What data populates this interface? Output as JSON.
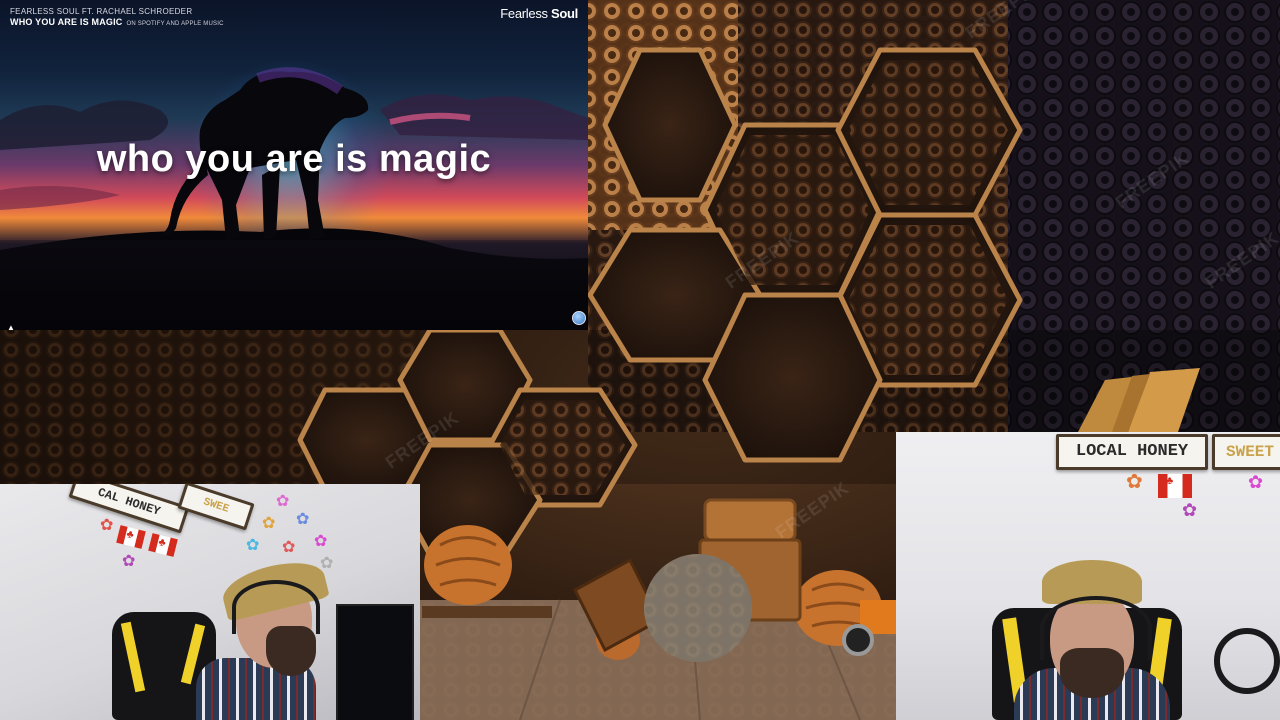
{
  "video": {
    "credit": "FEARLESS SOUL FT. RACHAEL SCHROEDER",
    "title": "WHO YOU ARE IS MAGIC",
    "title_sub": "ON SPOTIFY AND APPLE MUSIC",
    "brand_light": "Fearless",
    "brand_bold": "Soul",
    "lyric": "who you are is magic"
  },
  "background": {
    "watermark": "FREEPIK"
  },
  "cam_right": {
    "sign_main": "LOCAL HONEY",
    "sign_secondary": "SWEET"
  },
  "cam_left": {
    "sign_main": "CAL HONEY",
    "sign_secondary": "SWEE"
  },
  "colors": {
    "honey_accent": "#c9a24a",
    "chair_yellow": "#f0d12a",
    "flag_red": "#d52b1e"
  }
}
